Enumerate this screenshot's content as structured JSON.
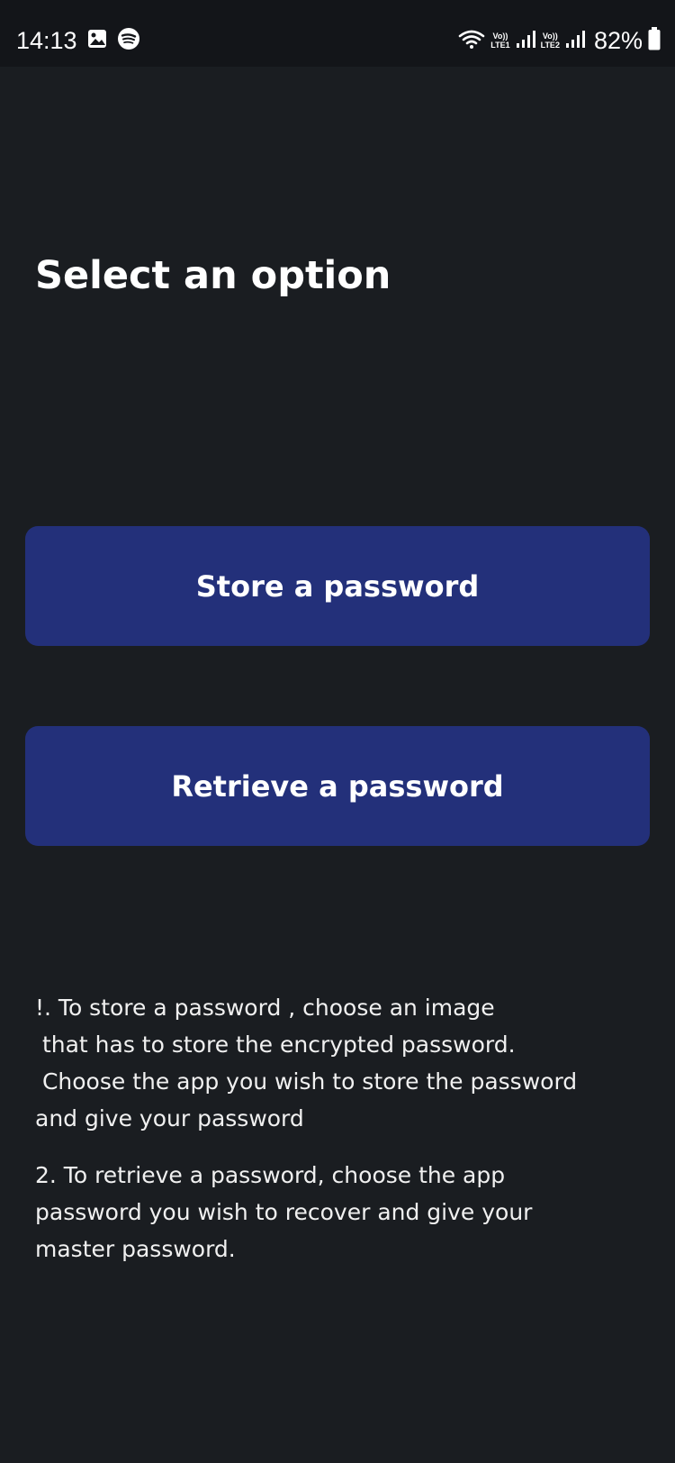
{
  "status_bar": {
    "time": "14:13",
    "left_icons": [
      "gallery-icon",
      "spotify-icon"
    ],
    "right_icons": [
      "wifi-icon",
      "signal-icon",
      "signal-icon",
      "battery-icon"
    ],
    "sim1_top": "Vo))",
    "sim1_bottom": "LTE1",
    "sim2_top": "Vo))",
    "sim2_bottom": "LTE2",
    "battery": "82%",
    "background_color": "#131519"
  },
  "main": {
    "title": "Select an option",
    "buttons": [
      {
        "label": "Store a password"
      },
      {
        "label": "Retrieve a password"
      }
    ],
    "instructions": {
      "p1": [
        "!. To store a password , choose an image",
        " that has to store the encrypted password.",
        " Choose the app you wish to store the password",
        "and give your password"
      ],
      "p2": [
        "2. To retrieve a password, choose the app",
        "password you wish to recover and give your",
        "master password."
      ]
    }
  },
  "colors": {
    "background": "#1a1d21",
    "button": "#23307a",
    "text": "#ffffff"
  }
}
